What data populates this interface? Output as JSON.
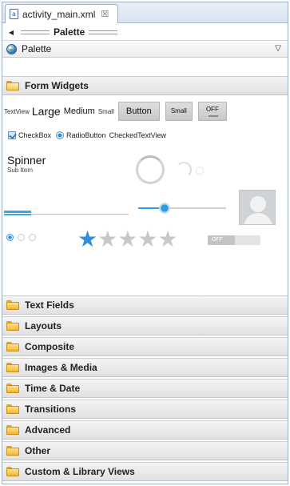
{
  "editor_tab": {
    "title": "activity_main.xml",
    "close_glyph": "☒"
  },
  "palette_header": {
    "title": "Palette"
  },
  "palette_selector": {
    "label": "Palette"
  },
  "form_widgets": {
    "label": "Form Widgets",
    "textview": "TextView",
    "large": "Large",
    "medium": "Medium",
    "small": "Small",
    "button": "Button",
    "small_button": "Small",
    "toggle": "OFF",
    "checkbox": "CheckBox",
    "radiobutton": "RadioButton",
    "checked_textview": "CheckedTextView",
    "spinner_title": "Spinner",
    "spinner_sub": "Sub Item",
    "seekbar_progress": 0.3,
    "horizontal_progress": 0.22,
    "rating_value": 1,
    "rating_max": 5,
    "switch_label": "OFF"
  },
  "categories": [
    {
      "label": "Text Fields"
    },
    {
      "label": "Layouts"
    },
    {
      "label": "Composite"
    },
    {
      "label": "Images & Media"
    },
    {
      "label": "Time & Date"
    },
    {
      "label": "Transitions"
    },
    {
      "label": "Advanced"
    },
    {
      "label": "Other"
    },
    {
      "label": "Custom & Library Views"
    }
  ],
  "colors": {
    "accent": "#2f8fdc",
    "folder": "#f3b935"
  },
  "icons": {
    "tab": "xml-file-icon",
    "nav": "left-arrow-icon",
    "palette": "globe-icon",
    "dropdown": "chevron-down-icon",
    "category": "folder-icon"
  }
}
